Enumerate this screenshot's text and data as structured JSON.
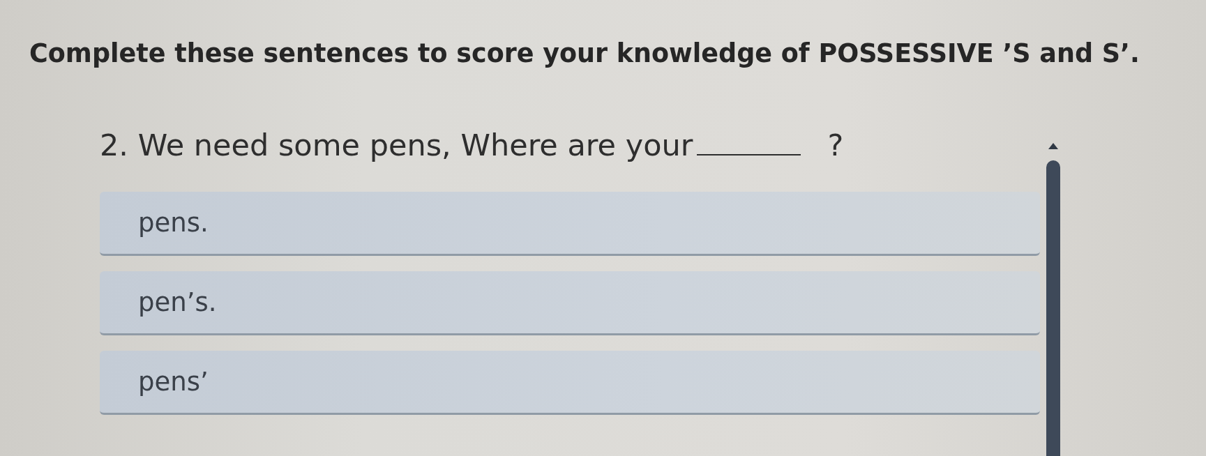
{
  "instructions": "Complete these sentences to score your knowledge of POSSESSIVE ’S and S’.",
  "question": {
    "prompt": "2. We need some pens, Where are your",
    "after_blank": "?"
  },
  "options": [
    {
      "label": "pens.",
      "selected": false
    },
    {
      "label": "pen’s.",
      "selected": false
    },
    {
      "label": "pens’",
      "selected": false
    }
  ]
}
